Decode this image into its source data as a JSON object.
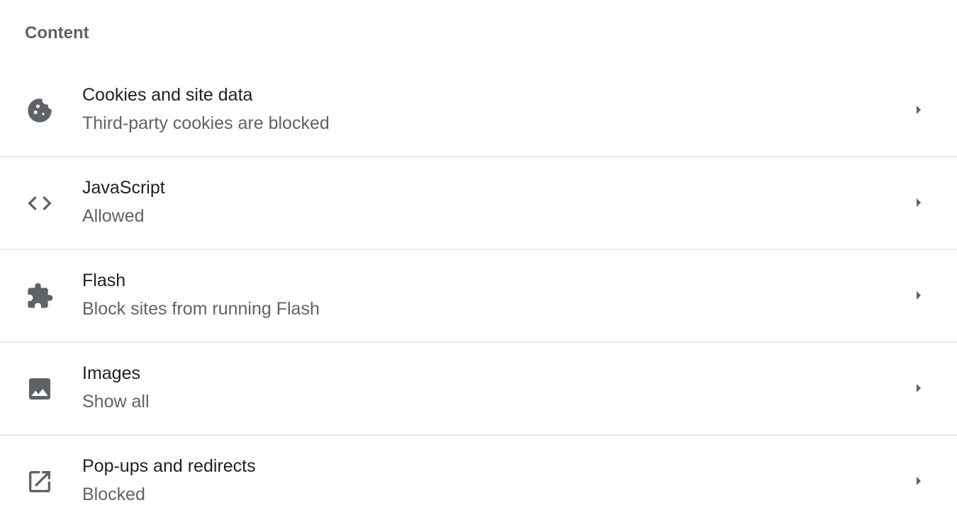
{
  "section": {
    "title": "Content"
  },
  "items": [
    {
      "title": "Cookies and site data",
      "subtitle": "Third-party cookies are blocked",
      "icon": "cookie-icon"
    },
    {
      "title": "JavaScript",
      "subtitle": "Allowed",
      "icon": "code-icon"
    },
    {
      "title": "Flash",
      "subtitle": "Block sites from running Flash",
      "icon": "puzzle-extension-icon"
    },
    {
      "title": "Images",
      "subtitle": "Show all",
      "icon": "image-icon"
    },
    {
      "title": "Pop-ups and redirects",
      "subtitle": "Blocked",
      "icon": "open-in-new-icon"
    }
  ],
  "colors": {
    "icon": "#5f6368",
    "title": "#202124",
    "subtitle": "#5f6368",
    "divider": "#e8eaed"
  }
}
